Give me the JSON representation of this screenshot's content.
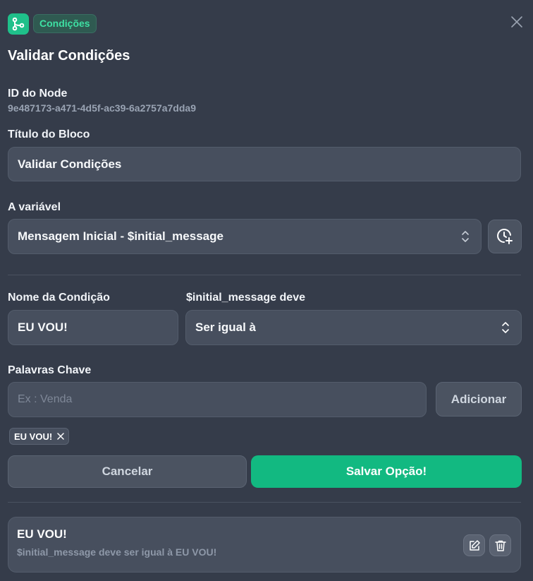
{
  "header": {
    "badge": "Condições",
    "title": "Validar Condições",
    "logo_icon": "branch-icon",
    "close_icon": "close-icon"
  },
  "node": {
    "id_label": "ID do Node",
    "id_value": "9e487173-a471-4d5f-ac39-6a2757a7dda9"
  },
  "block_title": {
    "label": "Título do Bloco",
    "value": "Validar Condições"
  },
  "variable": {
    "label": "A variável",
    "selected": "Mensagem Inicial - $initial_message",
    "history_icon": "clock-plus-icon"
  },
  "condition": {
    "name_label": "Nome da Condição",
    "name_value": "EU VOU!",
    "operator_label": "$initial_message deve",
    "operator_selected": "Ser igual à"
  },
  "keywords": {
    "label": "Palavras Chave",
    "placeholder": "Ex : Venda",
    "add_label": "Adicionar",
    "chips": [
      "EU VOU!"
    ]
  },
  "actions": {
    "cancel_label": "Cancelar",
    "save_label": "Salvar Opção!"
  },
  "options_list": [
    {
      "title": "EU VOU!",
      "description": "$initial_message deve ser igual à EU VOU!"
    }
  ],
  "colors": {
    "background": "#353c4a",
    "accent": "#12b981",
    "badge_text": "#3ee0a3"
  }
}
